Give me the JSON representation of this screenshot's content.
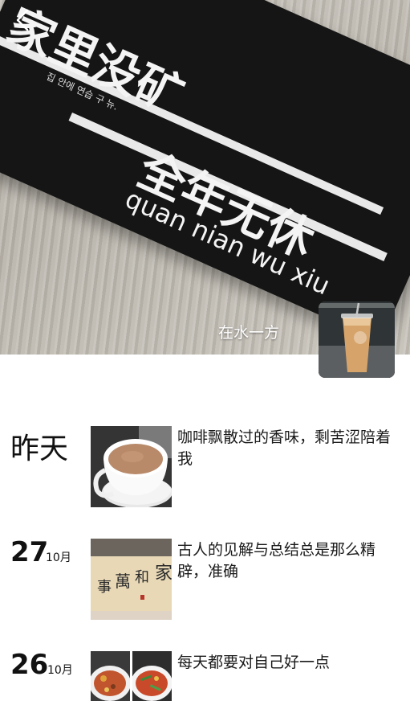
{
  "cover": {
    "plate_title_1": "家里没矿",
    "plate_korean": "집 안에 연습 구 뉴.",
    "plate_title_2": "全年无休",
    "plate_pinyin": "quan nian wu xiu",
    "profile_name": "在水一方"
  },
  "icons": {
    "back": "back-chevron-icon"
  },
  "feed": [
    {
      "date_word": "昨天",
      "caption": "咖啡飘散过的香味，剩苦涩陪着我"
    },
    {
      "day": "27",
      "month": "10月",
      "caption": "古人的见解与总结总是那么精辟，准确"
    },
    {
      "day": "26",
      "month": "10月",
      "caption": "每天都要对自己好一点"
    }
  ]
}
